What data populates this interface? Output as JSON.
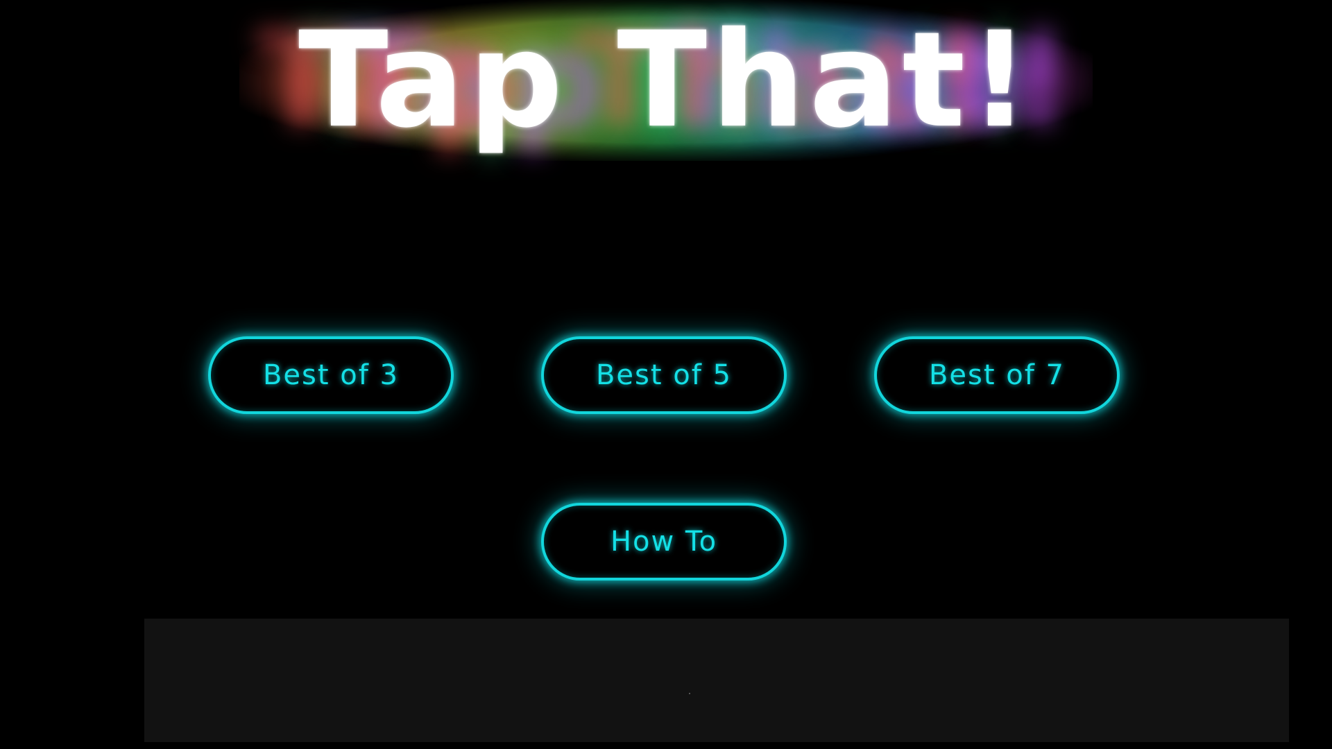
{
  "game": {
    "title": "Tap That!"
  },
  "menu": {
    "buttons": [
      {
        "id": "best3",
        "label": "Best of 3"
      },
      {
        "id": "best5",
        "label": "Best of 5"
      },
      {
        "id": "best7",
        "label": "Best of 7"
      },
      {
        "id": "howto",
        "label": "How To"
      }
    ]
  },
  "colors": {
    "background": "#000000",
    "button_neon": "#12d6dc",
    "title_text": "#ffffff",
    "bottom_panel": "#121212"
  }
}
